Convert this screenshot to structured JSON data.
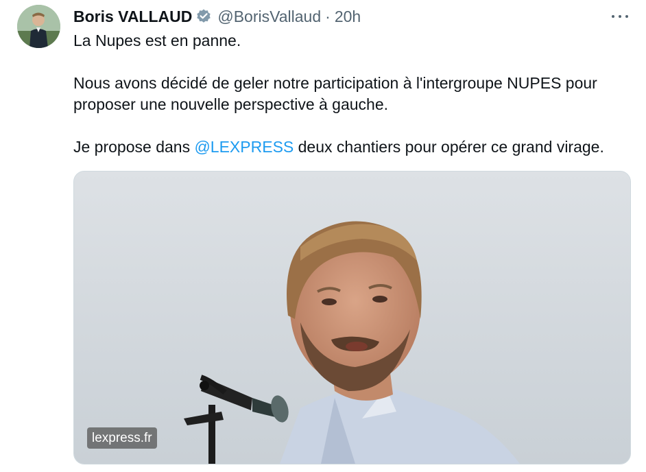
{
  "tweet": {
    "author_name": "Boris VALLAUD",
    "handle": "@BorisVallaud",
    "separator": "·",
    "time": "20h",
    "icons": {
      "verified": "verified-badge-icon",
      "more": "more-options-icon"
    },
    "text": {
      "line1": "La Nupes est en panne.",
      "para2": "Nous avons décidé de geler notre participation à l'intergroupe NUPES pour proposer une nouvelle perspective à gauche.",
      "para3_before": "Je propose dans ",
      "mention": "@LEXPRESS",
      "para3_after": " deux chantiers pour opérer ce grand virage."
    },
    "media": {
      "source_label": "lexpress.fr"
    }
  },
  "colors": {
    "text": "#0f1419",
    "secondary": "#536471",
    "link": "#1d9bf0",
    "verified": "#829aab"
  }
}
